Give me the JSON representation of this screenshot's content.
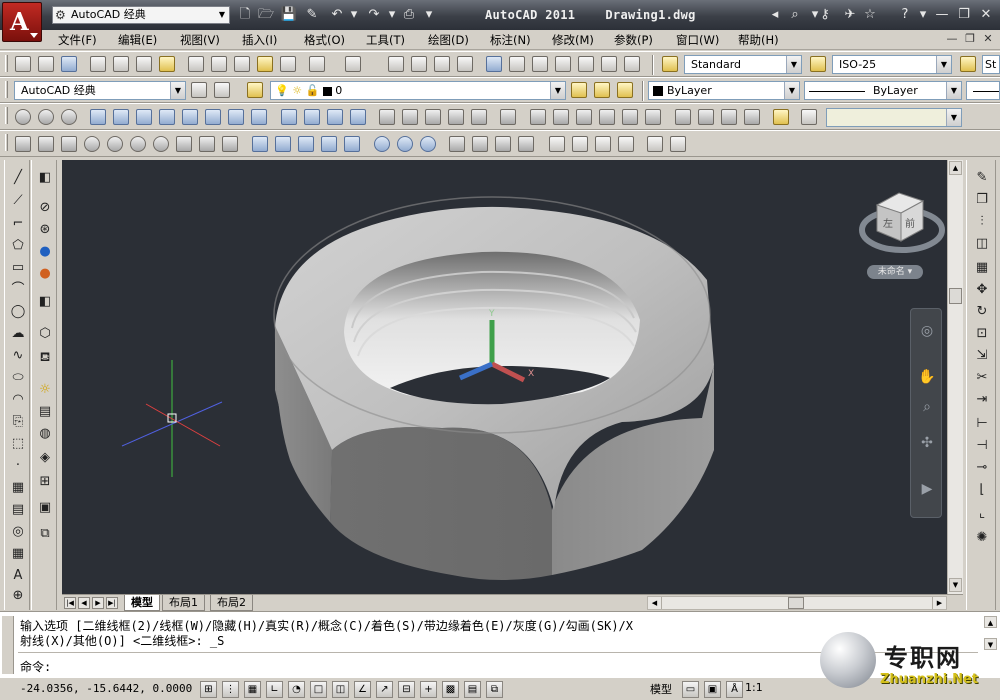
{
  "titlebar": {
    "workspace": "AutoCAD 经典",
    "app_name": "AutoCAD 2011",
    "file_name": "Drawing1.dwg",
    "logo_letter": "A"
  },
  "menu": [
    "文件(F)",
    "编辑(E)",
    "视图(V)",
    "插入(I)",
    "格式(O)",
    "工具(T)",
    "绘图(D)",
    "标注(N)",
    "修改(M)",
    "参数(P)",
    "窗口(W)",
    "帮助(H)"
  ],
  "toolbar": {
    "text_style": "Standard",
    "dim_style": "ISO-25",
    "table_style": "St",
    "workspace": "AutoCAD 经典",
    "layer": "0",
    "color": "ByLayer",
    "linetype": "ByLayer"
  },
  "viewcube": {
    "label": "未命名"
  },
  "layouts": {
    "tabs": [
      "模型",
      "布局1",
      "布局2"
    ],
    "active": 0
  },
  "command": {
    "line1": "输入选项 [二维线框(2)/线框(W)/隐藏(H)/真实(R)/概念(C)/着色(S)/带边缘着色(E)/灰度(G)/勾画(SK)/X",
    "line2": "射线(X)/其他(O)] <二维线框>: _S",
    "prompt": "命令:"
  },
  "status": {
    "coords": "-24.0356, -15.6442, 0.0000",
    "model": "模型",
    "scale": "1:1"
  },
  "watermark": {
    "cn": "专职网",
    "en": "Zhuanzhi.Net"
  },
  "colors": {
    "viewport_bg": "#2b2f36",
    "accent": "#b0201a"
  }
}
